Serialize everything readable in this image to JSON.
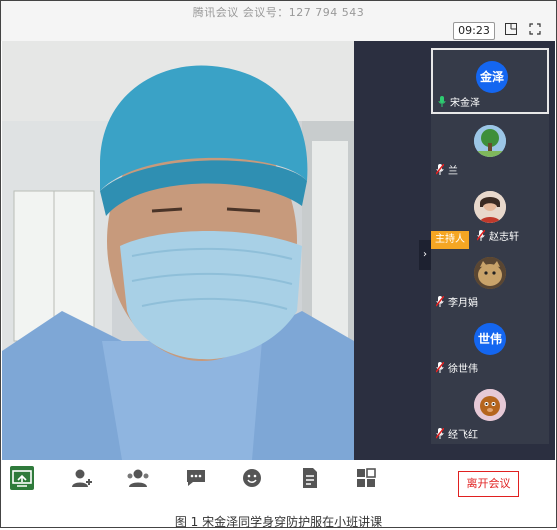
{
  "window": {
    "title": "腾讯会议  会议号：127 794 543",
    "timer": "09:23"
  },
  "participants": [
    {
      "name": "宋金泽",
      "avatar_text": "金泽",
      "avatar_color": "#1466f0",
      "mic": "on"
    },
    {
      "name": "兰",
      "avatar_text": "",
      "avatar_color": "#8bb8d9",
      "mic": "muted"
    },
    {
      "name": "赵志轩",
      "avatar_text": "",
      "avatar_color": "#d9c7b8",
      "mic": "muted"
    },
    {
      "name": "李月娟",
      "avatar_text": "",
      "avatar_color": "#a0743c",
      "mic": "muted"
    },
    {
      "name": "徐世伟",
      "avatar_text": "世伟",
      "avatar_color": "#1466f0",
      "mic": "muted"
    },
    {
      "name": "经飞红",
      "avatar_text": "",
      "avatar_color": "#c9a7b8",
      "mic": "muted"
    }
  ],
  "host_badge": "主持人",
  "toolbar": {
    "tools": [
      "screen-share-icon",
      "invite-icon",
      "participants-icon",
      "chat-icon",
      "reaction-icon",
      "document-icon",
      "apps-icon"
    ],
    "leave_label": "离开会议"
  },
  "caption": "图 1    宋金泽同学身穿防护服在小班讲课",
  "colors": {
    "accent": "#1466f0",
    "leave": "#e02020",
    "panel": "#2b2f40",
    "host": "#f5a623"
  }
}
